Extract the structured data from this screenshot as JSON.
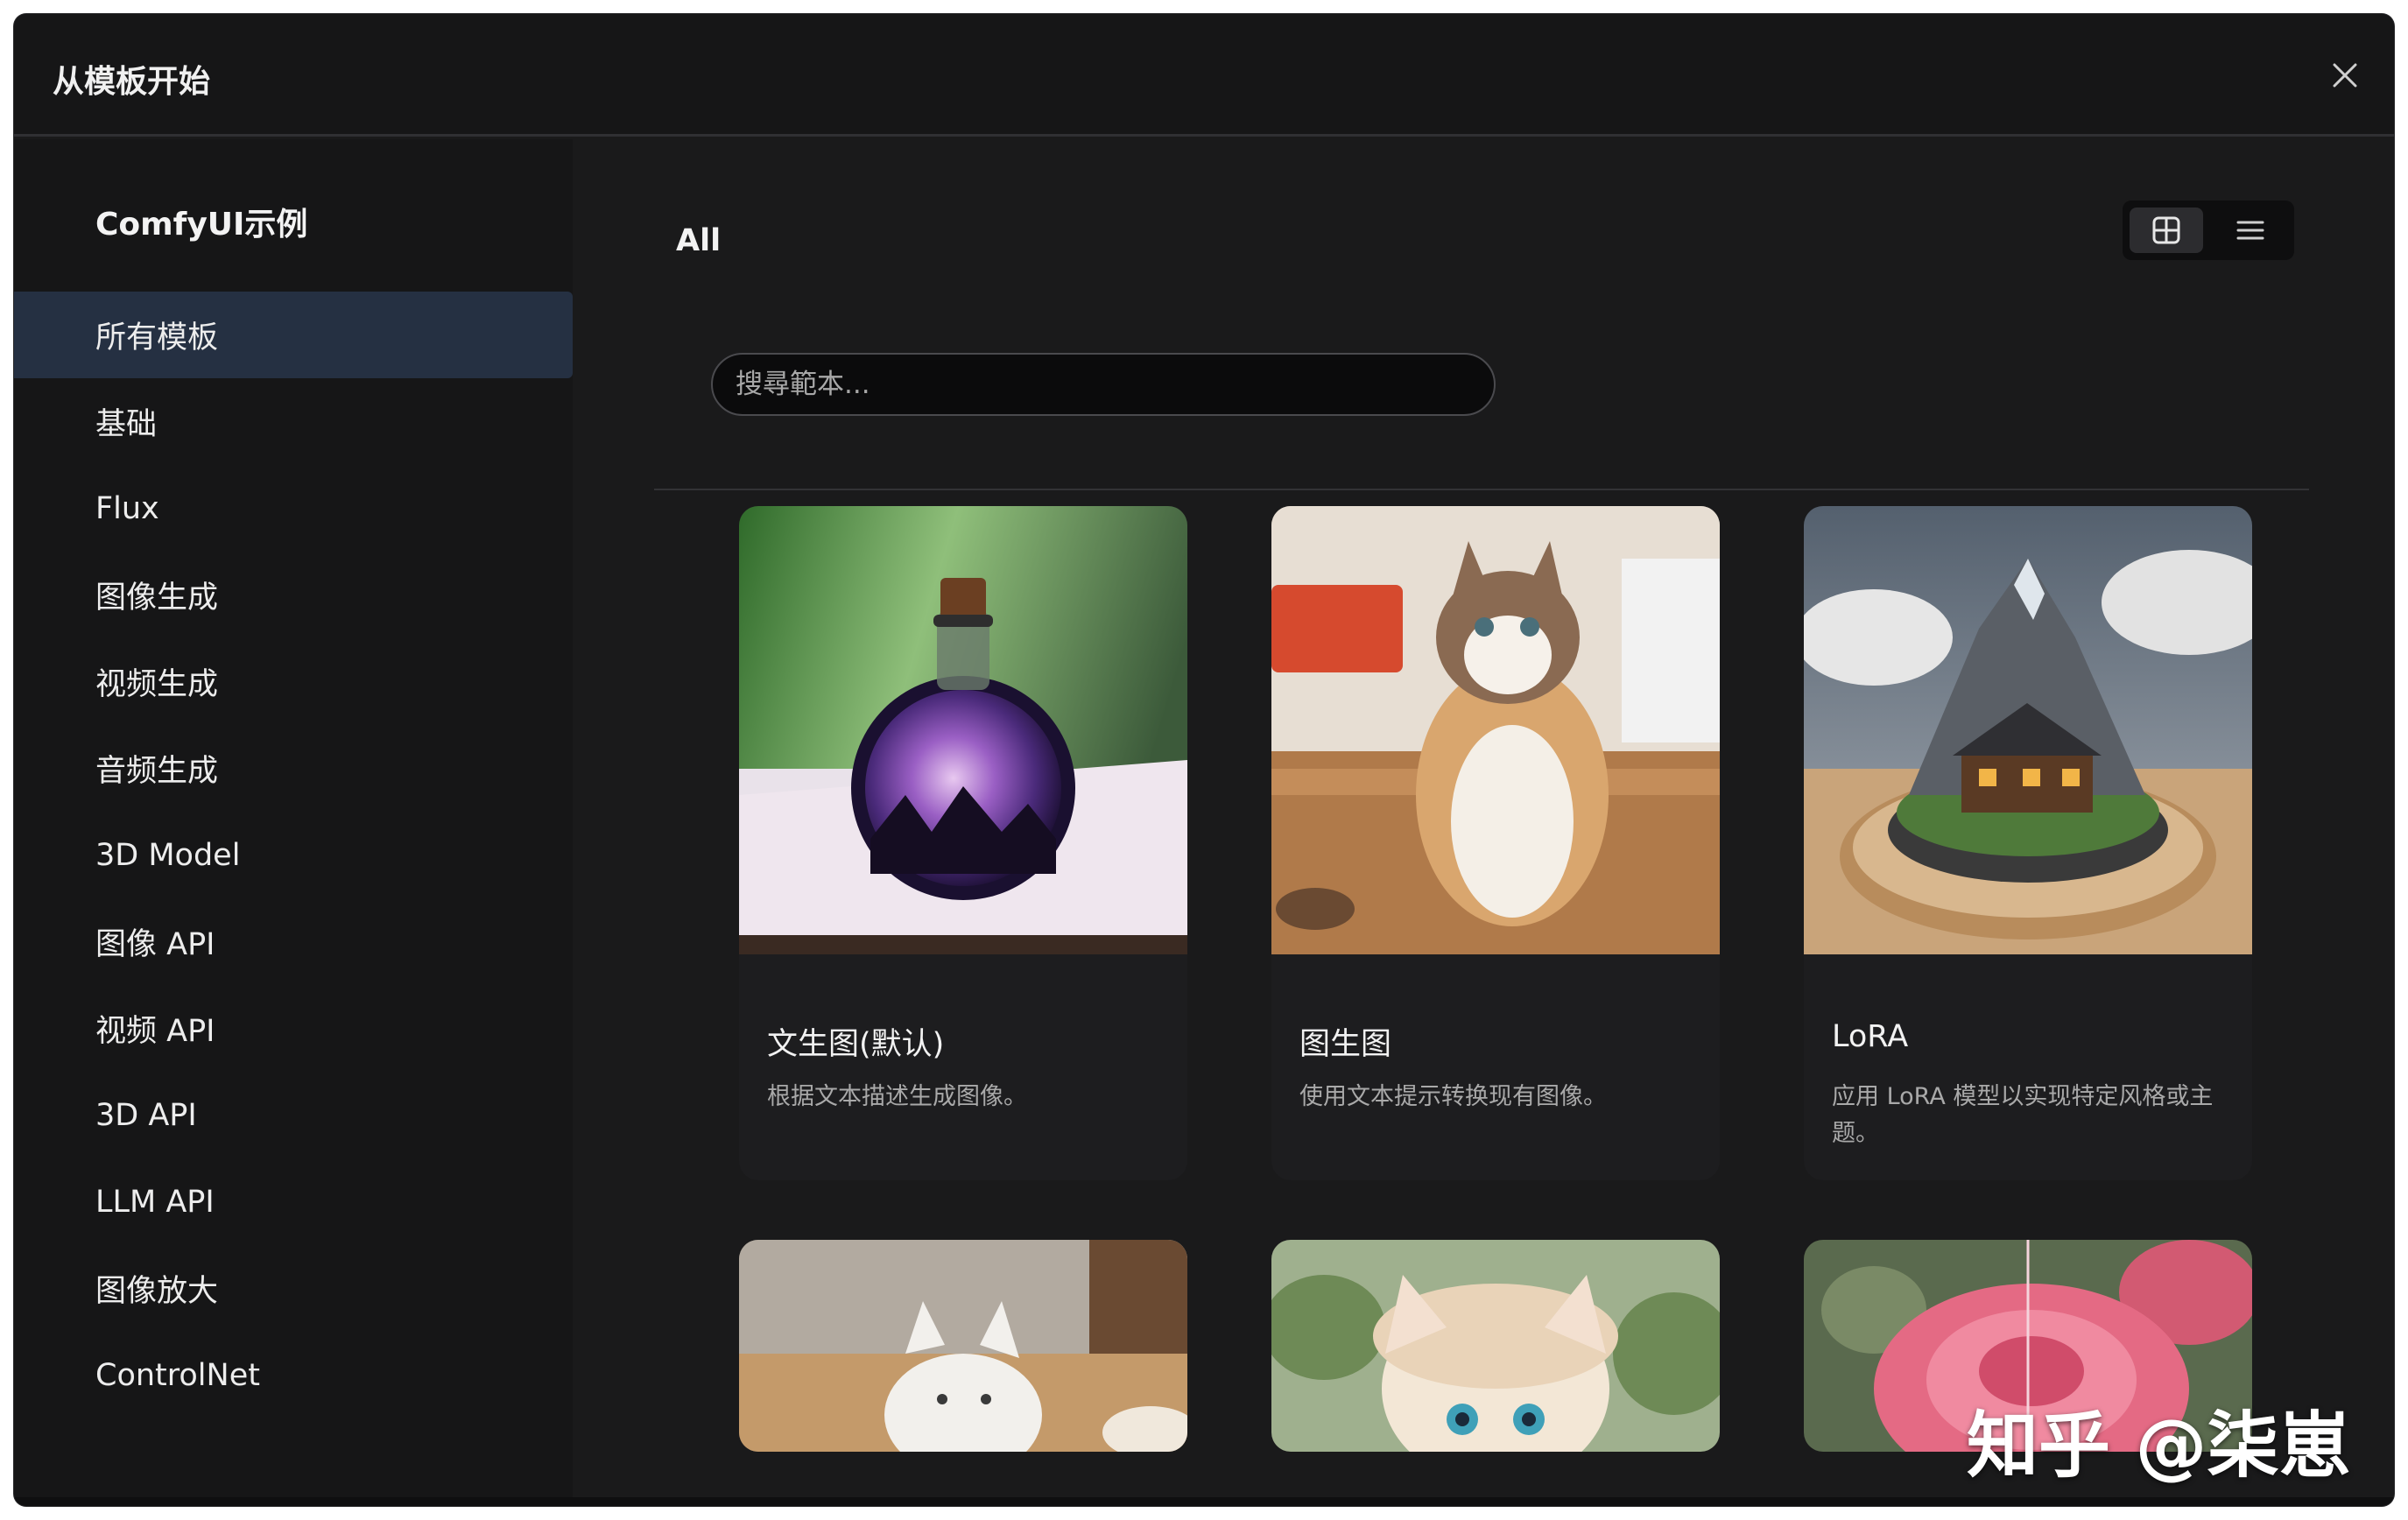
{
  "dialog": {
    "title": "从模板开始",
    "close_icon": "close-icon"
  },
  "sidebar": {
    "title": "ComfyUI示例",
    "items": [
      {
        "label": "所有模板",
        "active": true
      },
      {
        "label": "基础"
      },
      {
        "label": "Flux"
      },
      {
        "label": "图像生成"
      },
      {
        "label": "视频生成"
      },
      {
        "label": "音频生成"
      },
      {
        "label": "3D Model"
      },
      {
        "label": "图像 API"
      },
      {
        "label": "视频 API"
      },
      {
        "label": "3D API"
      },
      {
        "label": "LLM API"
      },
      {
        "label": "图像放大"
      },
      {
        "label": "ControlNet"
      }
    ]
  },
  "main": {
    "title": "All",
    "view_toggle": {
      "grid_icon": "grid-view-icon",
      "list_icon": "list-view-icon",
      "selected": "grid"
    },
    "search": {
      "placeholder": "搜尋範本...",
      "value": ""
    },
    "cards": [
      {
        "title": "文生图(默认)",
        "description": "根据文本描述生成图像。",
        "thumbnail": "potion-bottle-galaxy-image"
      },
      {
        "title": "图生图",
        "description": "使用文本提示转换现有图像。",
        "thumbnail": "tabby-cat-image"
      },
      {
        "title": "LoRA",
        "description": "应用 LoRA 模型以实现特定风格或主题。",
        "thumbnail": "mountain-cabin-island-image"
      },
      {
        "title": "",
        "description": "",
        "thumbnail": "ceramic-cat-coffee-image"
      },
      {
        "title": "",
        "description": "",
        "thumbnail": "fluffy-kitten-bonnet-image"
      },
      {
        "title": "",
        "description": "",
        "thumbnail": "pink-rose-image"
      }
    ]
  },
  "watermark": "知乎 @柒崽",
  "colors": {
    "background": "#1a1a1b",
    "sidebar": "#161617",
    "active_item": "#253042",
    "card": "#1d1d1f",
    "text_primary": "#f2f2f2",
    "text_secondary": "#a9a9a9"
  }
}
